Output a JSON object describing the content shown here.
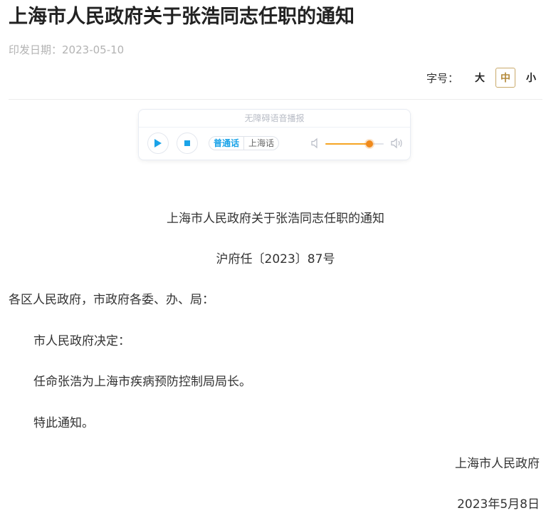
{
  "article": {
    "title": "上海市人民政府关于张浩同志任职的通知",
    "date_label": "印发日期：",
    "date_value": "2023-05-10"
  },
  "font_size": {
    "label": "字号：",
    "options": [
      "大",
      "中",
      "小"
    ],
    "selected": "中"
  },
  "player": {
    "header": "无障碍语音播报",
    "languages": [
      "普通话",
      "上海话"
    ],
    "selected_language": "普通话",
    "volume": 0.75,
    "accent_color": "#1aa3e8",
    "volume_color": "#f08a1c"
  },
  "document": {
    "heading": "上海市人民政府关于张浩同志任职的通知",
    "doc_number": "沪府任〔2023〕87号",
    "salutation": "各区人民政府，市政府各委、办、局：",
    "paragraphs": [
      "市人民政府决定：",
      "任命张浩为上海市疾病预防控制局局长。",
      "特此通知。"
    ],
    "issuer": "上海市人民政府",
    "issue_date": "2023年5月8日"
  }
}
